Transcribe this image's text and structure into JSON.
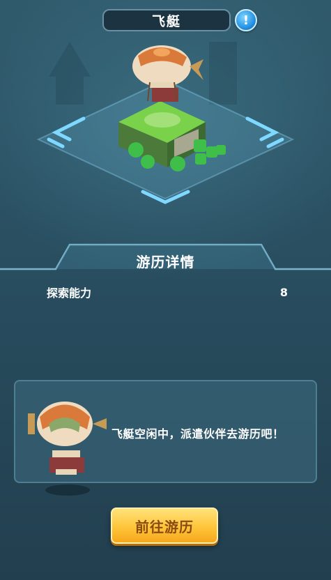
{
  "header": {
    "title": "飞艇",
    "info_icon": "exclamation-icon",
    "info_glyph": "!"
  },
  "panel": {
    "title": "游历详情",
    "stats": [
      {
        "label": "探索能力",
        "value": "8"
      }
    ]
  },
  "message": {
    "text": "飞艇空闲中，派遣伙伴去游历吧！"
  },
  "action": {
    "label": "前往游历"
  },
  "colors": {
    "accent_gold": "#ffc53a",
    "button_text": "#8a4a12",
    "panel_border": "#4e7e91",
    "info_blue": "#1f8ee0"
  }
}
